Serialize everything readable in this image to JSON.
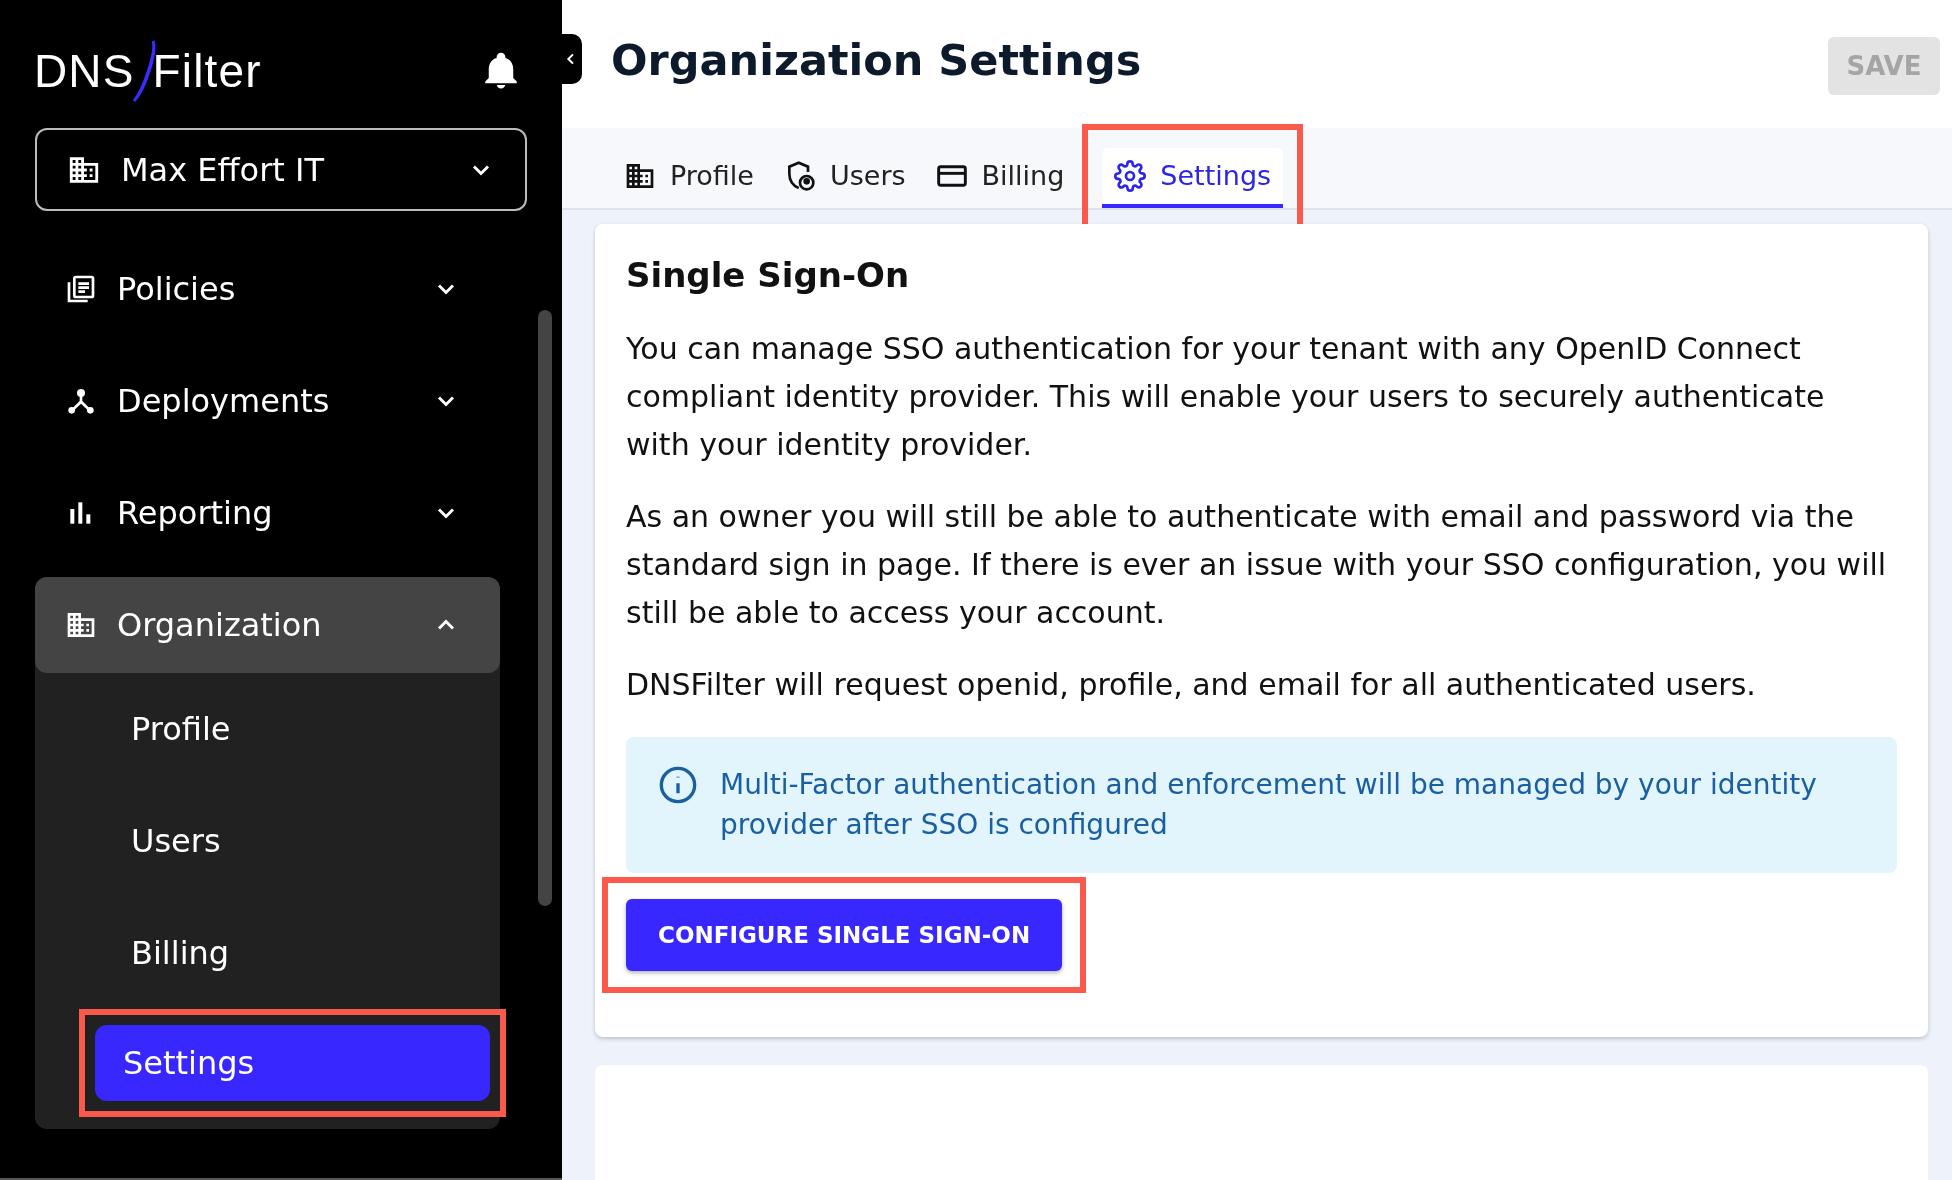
{
  "sidebar": {
    "logo": {
      "part1": "DNS",
      "part2": "Filter"
    },
    "org_selector": {
      "value": "Max Effort IT"
    },
    "items": [
      {
        "label": "Policies",
        "kind": "policies",
        "expanded": false,
        "selected": false
      },
      {
        "label": "Deployments",
        "kind": "deployments",
        "expanded": false,
        "selected": false
      },
      {
        "label": "Reporting",
        "kind": "reporting",
        "expanded": false,
        "selected": false
      },
      {
        "label": "Organization",
        "kind": "organization",
        "expanded": true,
        "selected": true,
        "children": [
          {
            "label": "Profile",
            "selected": false,
            "highlighted": false
          },
          {
            "label": "Users",
            "selected": false,
            "highlighted": false
          },
          {
            "label": "Billing",
            "selected": false,
            "highlighted": false
          },
          {
            "label": "Settings",
            "selected": true,
            "highlighted": true
          }
        ]
      }
    ]
  },
  "header": {
    "title": "Organization Settings",
    "save_button": {
      "label": "SAVE",
      "disabled": true
    }
  },
  "tabs": [
    {
      "label": "Profile",
      "kind": "profile",
      "selected": false,
      "highlighted": false
    },
    {
      "label": "Users",
      "kind": "users",
      "selected": false,
      "highlighted": false
    },
    {
      "label": "Billing",
      "kind": "billing",
      "selected": false,
      "highlighted": false
    },
    {
      "label": "Settings",
      "kind": "settings",
      "selected": true,
      "highlighted": true
    }
  ],
  "sso_card": {
    "title": "Single Sign-On",
    "paragraphs": [
      "You can manage SSO authentication for your tenant with any OpenID Connect compliant identity provider. This will enable your users to securely authenticate with your identity provider.",
      "As an owner you will still be able to authenticate with email and password via the standard sign in page. If there is ever an issue with your SSO configuration, you will still be able to access your account.",
      "DNSFilter will request openid, profile, and email for all authenticated users."
    ],
    "info": "Multi-Factor authentication and enforcement will be managed by your identity provider after SSO is configured",
    "button": {
      "label": "CONFIGURE SINGLE SIGN-ON",
      "highlighted": true
    }
  }
}
